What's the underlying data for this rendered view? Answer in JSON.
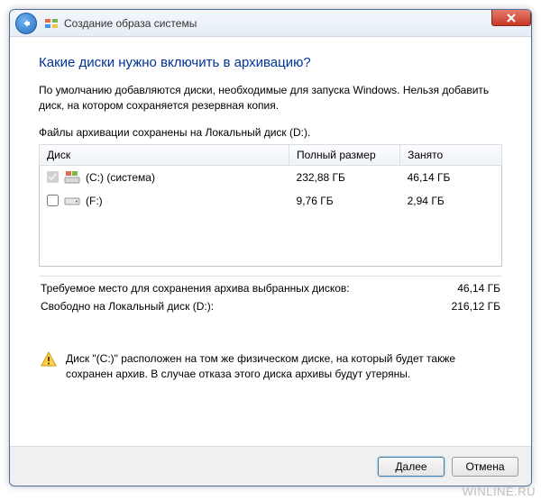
{
  "titlebar": {
    "title": "Создание образа системы"
  },
  "main": {
    "heading": "Какие диски нужно включить в архивацию?",
    "description": "По умолчанию добавляются диски, необходимые для запуска Windows. Нельзя добавить диск, на котором сохраняется резервная копия.",
    "saved_location_label": "Файлы архивации сохранены на Локальный диск (D:)."
  },
  "table": {
    "columns": {
      "disk": "Диск",
      "full_size": "Полный размер",
      "used": "Занято"
    },
    "rows": [
      {
        "checked": true,
        "disabled": true,
        "system": true,
        "name": "(C:) (система)",
        "full_size": "232,88 ГБ",
        "used": "46,14 ГБ"
      },
      {
        "checked": false,
        "disabled": false,
        "system": false,
        "name": "(F:)",
        "full_size": "9,76 ГБ",
        "used": "2,94 ГБ"
      }
    ]
  },
  "summary": {
    "required_label": "Требуемое место для сохранения архива выбранных дисков:",
    "required_value": "46,14 ГБ",
    "free_label": "Свободно на Локальный диск (D:):",
    "free_value": "216,12 ГБ"
  },
  "warning": {
    "text": "Диск \"(C:)\" расположен на том же физическом диске, на который будет также сохранен архив. В случае отказа этого диска архивы будут утеряны."
  },
  "footer": {
    "next": "Далее",
    "cancel": "Отмена"
  },
  "watermark": "WINLINE.RU"
}
